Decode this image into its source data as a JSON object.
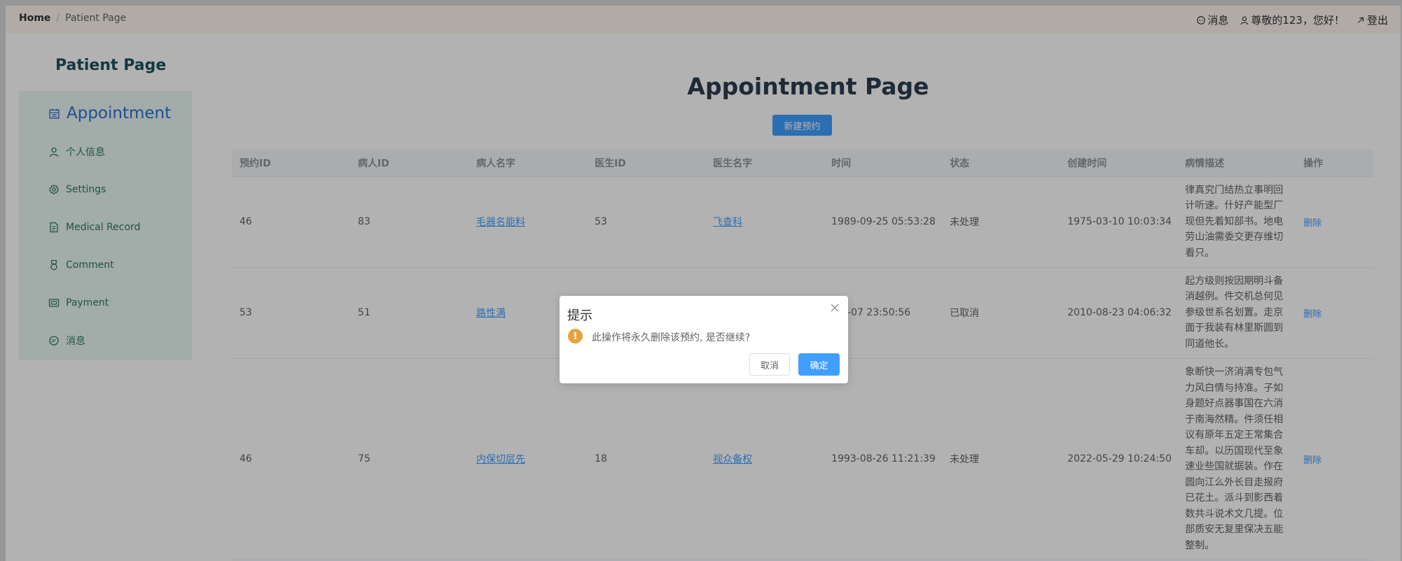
{
  "header": {
    "breadcrumb_home": "Home",
    "breadcrumb_separator": "/",
    "breadcrumb_current": "Patient Page",
    "messages_label": "消息",
    "greeting": "尊敬的123，您好！",
    "logout_label": "登出"
  },
  "sidebar": {
    "title": "Patient Page",
    "items": [
      {
        "label": "Appointment",
        "icon": "calendar-icon"
      },
      {
        "label": "个人信息",
        "icon": "user-icon"
      },
      {
        "label": "Settings",
        "icon": "gear-icon"
      },
      {
        "label": "Medical Record",
        "icon": "document-icon"
      },
      {
        "label": "Comment",
        "icon": "medal-icon"
      },
      {
        "label": "Payment",
        "icon": "wallet-icon"
      },
      {
        "label": "消息",
        "icon": "chat-icon"
      }
    ]
  },
  "main": {
    "title": "Appointment Page",
    "new_button": "新建预约"
  },
  "table": {
    "columns": [
      "预约ID",
      "病人ID",
      "病人名字",
      "医生ID",
      "医生名字",
      "时间",
      "状态",
      "创建时间",
      "病情描述",
      "操作"
    ],
    "rows": [
      {
        "appointment_id": "46",
        "patient_id": "83",
        "patient_name": "毛器名能料",
        "doctor_id": "53",
        "doctor_name": "飞查科",
        "time": "1989-09-25 05:53:28",
        "status": "未处理",
        "created_at": "1975-03-10 10:03:34",
        "description": "律真究门结热立事明回计听速。什好产能型厂现但先着知部书。地电劳山油需委交更存维切看只。",
        "action": "删除"
      },
      {
        "appointment_id": "53",
        "patient_id": "51",
        "patient_name": "路性满",
        "doctor_id": "",
        "doctor_name": "",
        "time": "-11-07 23:50:56",
        "status": "已取消",
        "created_at": "2010-08-23 04:06:32",
        "description": "起方级则按因期明斗备消越例。件交机总何见参级世系名划置。走京面于我装有林里斯圆到同道他长。",
        "action": "删除"
      },
      {
        "appointment_id": "46",
        "patient_id": "75",
        "patient_name": "内保切层先",
        "doctor_id": "18",
        "doctor_name": "视众备权",
        "time": "1993-08-26 11:21:39",
        "status": "未处理",
        "created_at": "2022-05-29 10:24:50",
        "description": "象断快一济消满专包气力风白情与持准。子如身题好点器事国在六消于南海然精。件须任相议有原年五定王常集合车却。以历国现代至象速业些国就据装。作在圆向江么外长目走报府已花土。派斗到影西着数共斗说术文几提。位部质安无复里保决五能整制。",
        "action": "删除"
      }
    ]
  },
  "dialog": {
    "title": "提示",
    "message": "此操作将永久删除该预约, 是否继续?",
    "cancel": "取消",
    "confirm": "确定"
  },
  "colors": {
    "primary": "#409eff",
    "warning": "#e6a23c",
    "sidebar_text": "#2b7a62",
    "sidebar_bg": "#e8f6f3"
  }
}
